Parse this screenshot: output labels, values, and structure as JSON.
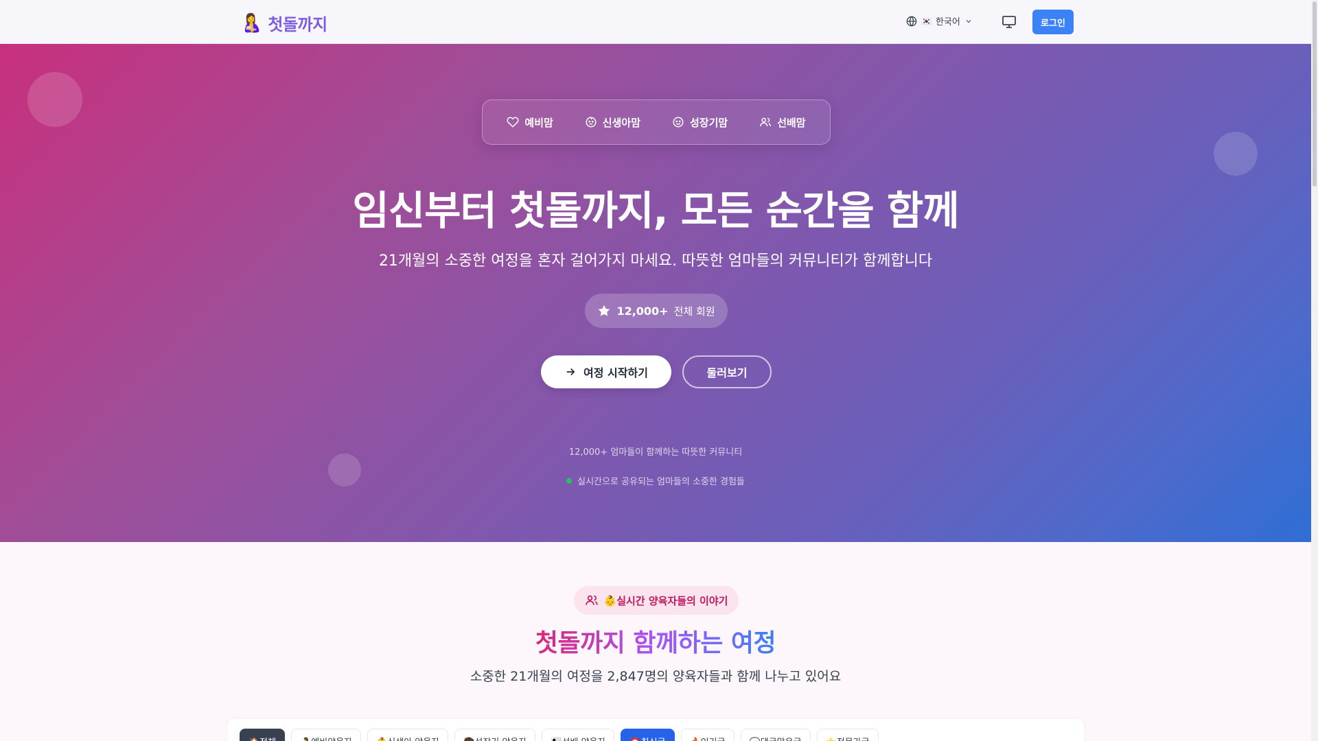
{
  "header": {
    "logo_emoji": "🤱",
    "logo_text": "첫돌까지",
    "language_flag": "🇰🇷",
    "language_label": "한국어",
    "login_label": "로그인"
  },
  "hero": {
    "tabs": [
      {
        "label": "예비맘",
        "icon": "heart-icon"
      },
      {
        "label": "신생아맘",
        "icon": "baby-face-icon"
      },
      {
        "label": "성장기맘",
        "icon": "smile-face-icon"
      },
      {
        "label": "선배맘",
        "icon": "users-icon"
      }
    ],
    "title": "임신부터 첫돌까지, 모든 순간을 함께",
    "subtitle": "21개월의 소중한 여정을 혼자 걸어가지 마세요. 따뜻한 엄마들의 커뮤니티가 함께합니다",
    "stat_number": "12,000+",
    "stat_label": "전체 회원",
    "start_button": "여정 시작하기",
    "browse_button": "둘러보기",
    "note": "12,000+ 엄마들이 함께하는 따뜻한 커뮤니티",
    "live_text": "실시간으로 공유되는 엄마들의 소중한 경험들"
  },
  "section": {
    "badge": "👶실시간 양육자들의 이야기",
    "title": "첫돌까지 함께하는 여정",
    "subtitle": "소중한 21개월의 여정을 2,847명의 양육자들과 함께 나누고 있어요",
    "filters": [
      {
        "label": "🏠전체",
        "style": "dark"
      },
      {
        "label": "🤰예비양육자",
        "style": "plain"
      },
      {
        "label": "👶신생아 양육자",
        "style": "plain"
      },
      {
        "label": "🧒성장기 양육자",
        "style": "plain"
      },
      {
        "label": "👩‍👧선배 양육자",
        "style": "plain"
      },
      {
        "label": "⏰최신글",
        "style": "blue"
      },
      {
        "label": "🔥인기글",
        "style": "plain"
      },
      {
        "label": "💬댓글많은글",
        "style": "plain"
      },
      {
        "label": "⭐전문가글",
        "style": "plain"
      }
    ]
  },
  "colors": {
    "brand_purple": "#7c5ce0",
    "login_blue": "#3b82f6",
    "hero_gradient_start": "#c8307d",
    "hero_gradient_end": "#2f6ed4",
    "badge_pink": "#be185d",
    "live_green": "#22c55e"
  }
}
